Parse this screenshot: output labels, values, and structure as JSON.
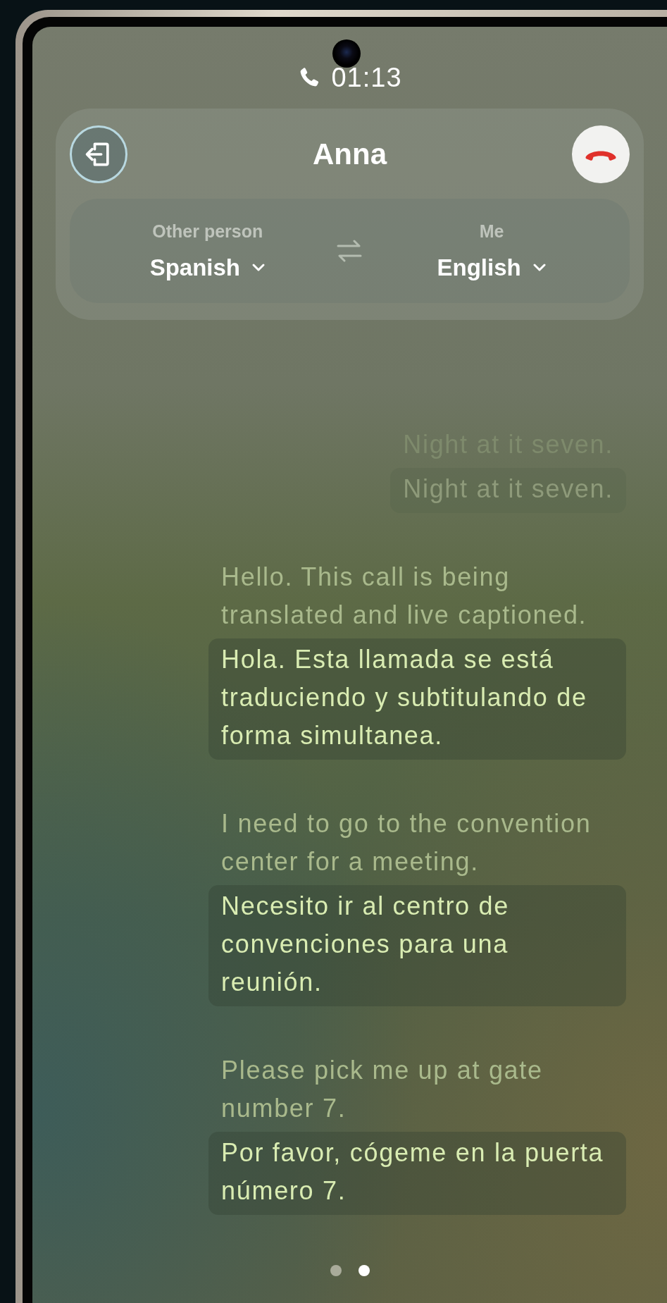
{
  "status": {
    "call_time": "01:13"
  },
  "header": {
    "contact_name": "Anna",
    "other_label": "Other person",
    "other_language": "Spanish",
    "me_label": "Me",
    "me_language": "English"
  },
  "messages": [
    {
      "original": "Night at it seven.",
      "translation": "Night at it seven.",
      "faded": true
    },
    {
      "original": "Hello. This call is being translated and live captioned.",
      "translation": "Hola. Esta llamada se está traduciendo y subtitulando de forma simultanea.",
      "faded": false
    },
    {
      "original": "I need to go to the convention center for a meeting.",
      "translation": "Necesito ir al centro de convenciones para una reunión.",
      "faded": false
    },
    {
      "original": "Please pick me up at gate number 7.",
      "translation": "Por favor, cógeme en la puerta número 7.",
      "faded": false
    }
  ],
  "pages": [
    {
      "selected": false
    },
    {
      "selected": true
    }
  ]
}
